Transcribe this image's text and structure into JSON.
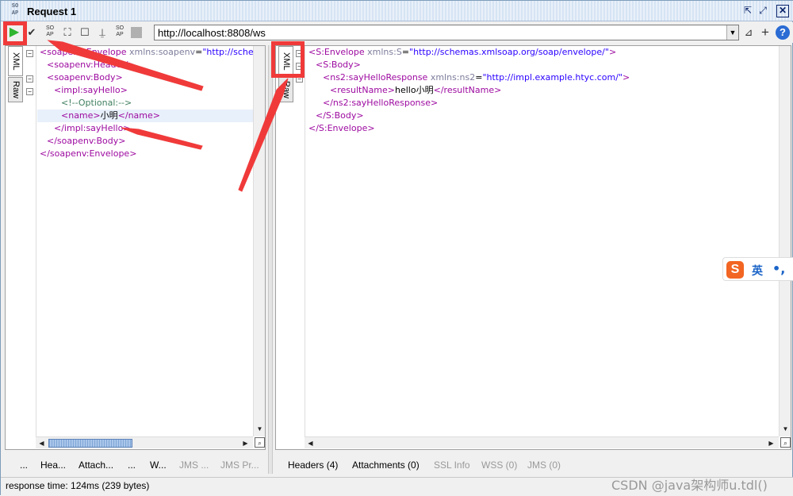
{
  "window": {
    "title": "Request 1",
    "app_icon": "SO AP"
  },
  "toolbar": {
    "url": "http://localhost:8808/ws"
  },
  "request": {
    "tabs": [
      "XML",
      "Raw"
    ],
    "lines": [
      {
        "indent": 0,
        "parts": [
          [
            "tag",
            "<soapenv:Envelope "
          ],
          [
            "at",
            "xmlns:soapenv"
          ],
          [
            "tx",
            "="
          ],
          [
            "val",
            "\"http://schemas.xml"
          ]
        ]
      },
      {
        "indent": 1,
        "parts": [
          [
            "tag",
            "<soapenv:Header/>"
          ]
        ]
      },
      {
        "indent": 1,
        "parts": [
          [
            "tag",
            "<soapenv:Body>"
          ]
        ]
      },
      {
        "indent": 2,
        "parts": [
          [
            "tag",
            "<impl:sayHello>"
          ]
        ]
      },
      {
        "indent": 3,
        "parts": [
          [
            "cm",
            "<!--Optional:-->"
          ]
        ]
      },
      {
        "indent": 3,
        "parts": [
          [
            "tag",
            "<name>"
          ],
          [
            "tx",
            "小明"
          ],
          [
            "tag",
            "</name>"
          ]
        ]
      },
      {
        "indent": 2,
        "parts": [
          [
            "tag",
            "</impl:sayHello>"
          ]
        ]
      },
      {
        "indent": 1,
        "parts": [
          [
            "tag",
            "</soapenv:Body>"
          ]
        ]
      },
      {
        "indent": 0,
        "parts": [
          [
            "tag",
            "</soapenv:Envelope>"
          ]
        ]
      }
    ],
    "bottom_tabs": [
      "...",
      "Hea...",
      "Attach...",
      "...",
      "W...",
      "JMS ...",
      "JMS Pr..."
    ]
  },
  "response": {
    "tabs": [
      "XML",
      "Raw"
    ],
    "lines": [
      {
        "indent": 0,
        "parts": [
          [
            "tag",
            "<S:Envelope "
          ],
          [
            "at",
            "xmlns:S"
          ],
          [
            "tx",
            "="
          ],
          [
            "val",
            "\"http://schemas.xmlsoap.org/soap/envelope/\""
          ],
          [
            "tag",
            ">"
          ]
        ]
      },
      {
        "indent": 1,
        "parts": [
          [
            "tag",
            "<S:Body>"
          ]
        ]
      },
      {
        "indent": 2,
        "parts": [
          [
            "tag",
            "<ns2:sayHelloResponse "
          ],
          [
            "at",
            "xmlns:ns2"
          ],
          [
            "tx",
            "="
          ],
          [
            "val",
            "\"http://impl.example.htyc.com/\""
          ],
          [
            "tag",
            ">"
          ]
        ]
      },
      {
        "indent": 3,
        "parts": [
          [
            "tag",
            "<resultName>"
          ],
          [
            "tx",
            "hello小明"
          ],
          [
            "tag",
            "</resultName>"
          ]
        ]
      },
      {
        "indent": 2,
        "parts": [
          [
            "tag",
            "</ns2:sayHelloResponse>"
          ]
        ]
      },
      {
        "indent": 1,
        "parts": [
          [
            "tag",
            "</S:Body>"
          ]
        ]
      },
      {
        "indent": 0,
        "parts": [
          [
            "tag",
            "</S:Envelope>"
          ]
        ]
      }
    ],
    "bottom_tabs": [
      "Headers (4)",
      "Attachments (0)",
      "SSL Info",
      "WSS (0)",
      "JMS (0)"
    ]
  },
  "ime": {
    "logo": "S",
    "mode": "英",
    "punct": "•,"
  },
  "status": {
    "text": "response time: 124ms (239 bytes)",
    "watermark": "CSDN @java架构师u.tdl()"
  }
}
